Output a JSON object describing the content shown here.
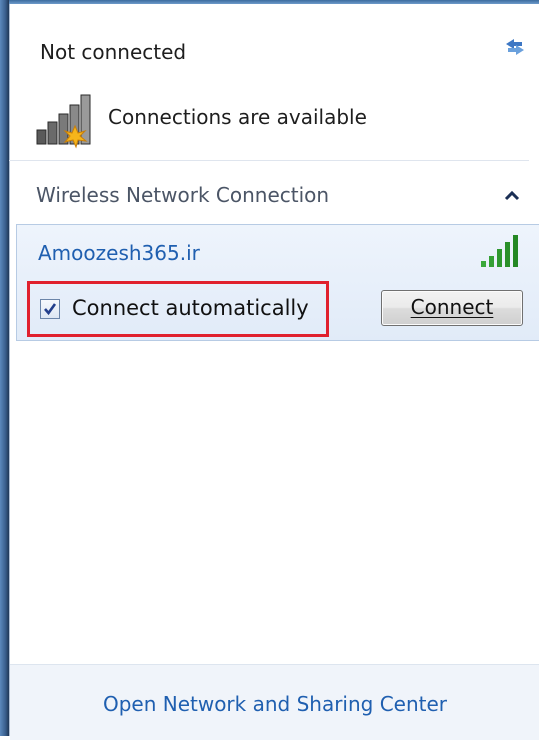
{
  "header": {
    "title": "Not connected",
    "subtitle": "Connections are available",
    "refresh_icon": "refresh-arrows-icon",
    "status_icon": "signal-bars-star-icon"
  },
  "section": {
    "label": "Wireless Network Connection",
    "collapse_icon": "chevron-up-icon"
  },
  "network": {
    "name": "Amoozesh365.ir",
    "signal_level": "5 of 5 bars",
    "signal_icon": "signal-bars-icon",
    "connect_automatically_label": "Connect automatically",
    "connect_automatically_checked": true,
    "connect_button_label": "Connect",
    "connect_button_access_key": "C"
  },
  "footer": {
    "link_label": "Open Network and Sharing Center"
  },
  "colors": {
    "link": "#1f5fb0",
    "highlight_box": "#e0202d",
    "selected_background": "#e8f0fb",
    "signal_green": "#2ea02e"
  }
}
